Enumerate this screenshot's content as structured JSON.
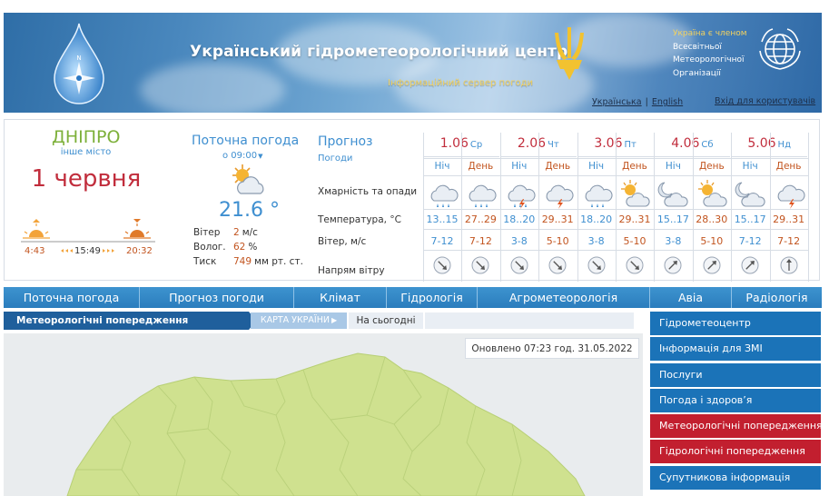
{
  "header": {
    "title": "Український гідрометеорологічний центр",
    "subtitle": "Інформаційний сервер погоди",
    "wmo_lines": [
      "Україна є членом",
      "Всесвітньої",
      "Метеорологічної",
      "Організації"
    ],
    "lang_ua": "Українська",
    "lang_sep": "|",
    "lang_en": "English",
    "login": "Вхід для користувачів"
  },
  "colors": {
    "accent_blue": "#3f8fd0",
    "date_red": "#c12d3c",
    "warm": "#c2541f",
    "city_green": "#7db03a",
    "menu_blue": "#2b7dbd",
    "sidebar_red": "#c21f2f"
  },
  "city": {
    "name": "ДНІПРО",
    "other": "інше місто",
    "date": "1 червня",
    "sunrise": "4:43",
    "day_length": "15:49",
    "sunset": "20:32"
  },
  "current": {
    "title": "Поточна погода",
    "time": "о 09:00",
    "icon": "sun-cloud-icon",
    "temp": "21.6 °",
    "wind_label": "Вітер",
    "wind_value": "2",
    "wind_unit": "м/с",
    "humidity_label": "Волог.",
    "humidity_value": "62",
    "humidity_unit": "%",
    "pressure_label": "Тиск",
    "pressure_value": "749",
    "pressure_unit": "мм рт. ст."
  },
  "forecast": {
    "title": "Прогноз",
    "subtitle": "Погоди",
    "row_labels": {
      "cloud": "Хмарність та опади",
      "temp": "Температура, °С",
      "wind": "Вітер, м/с",
      "dir": "Напрям вітру"
    },
    "days": [
      {
        "date": "1.06",
        "dow": "Ср",
        "night": {
          "label": "Ніч",
          "icon": "rain-cloud",
          "temp": "13..15",
          "wind": "7-12",
          "dir_deg": 315
        },
        "day": {
          "label": "День",
          "icon": "rain-cloud",
          "temp": "27..29",
          "wind": "7-12",
          "dir_deg": 315
        }
      },
      {
        "date": "2.06",
        "dow": "Чт",
        "night": {
          "label": "Ніч",
          "icon": "thunder-rain-cloud",
          "temp": "18..20",
          "wind": "3-8",
          "dir_deg": 315
        },
        "day": {
          "label": "День",
          "icon": "thunder-cloud",
          "temp": "29..31",
          "wind": "5-10",
          "dir_deg": 315
        }
      },
      {
        "date": "3.06",
        "dow": "Пт",
        "night": {
          "label": "Ніч",
          "icon": "rain-cloud",
          "temp": "18..20",
          "wind": "3-8",
          "dir_deg": 315
        },
        "day": {
          "label": "День",
          "icon": "sun-cloud",
          "temp": "29..31",
          "wind": "5-10",
          "dir_deg": 315
        }
      },
      {
        "date": "4.06",
        "dow": "Сб",
        "night": {
          "label": "Ніч",
          "icon": "moon-cloud",
          "temp": "15..17",
          "wind": "3-8",
          "dir_deg": 225
        },
        "day": {
          "label": "День",
          "icon": "sun-cloud",
          "temp": "28..30",
          "wind": "5-10",
          "dir_deg": 225
        }
      },
      {
        "date": "5.06",
        "dow": "Нд",
        "night": {
          "label": "Ніч",
          "icon": "moon-cloud",
          "temp": "15..17",
          "wind": "7-12",
          "dir_deg": 225
        },
        "day": {
          "label": "День",
          "icon": "thunder-cloud",
          "temp": "29..31",
          "wind": "7-12",
          "dir_deg": 180
        }
      }
    ]
  },
  "menu": [
    "Поточна погода",
    "Прогноз погоди",
    "Клімат",
    "Гідрологія",
    "Агрометеорологія",
    "Авіа",
    "Радіологія"
  ],
  "tabs": {
    "warnings": "Метеорологічні попередження",
    "map": "КАРТА УКРАЇНИ",
    "today": "На сьогодні"
  },
  "updated": "Оновлено 07:23 год. 31.05.2022",
  "sidebar": [
    {
      "label": "Гідрометеоцентр",
      "color": "#1b73b8"
    },
    {
      "label": "Інформація для ЗМІ",
      "color": "#1b73b8"
    },
    {
      "label": "Послуги",
      "color": "#1b73b8"
    },
    {
      "label": "Погода і здоров’я",
      "color": "#1b73b8"
    },
    {
      "label": "Метеорологічні попередження",
      "color": "#c21f2f"
    },
    {
      "label": "Гідрологічні попередження",
      "color": "#c21f2f"
    },
    {
      "label": "Супутникова інформація",
      "color": "#1b73b8"
    }
  ]
}
